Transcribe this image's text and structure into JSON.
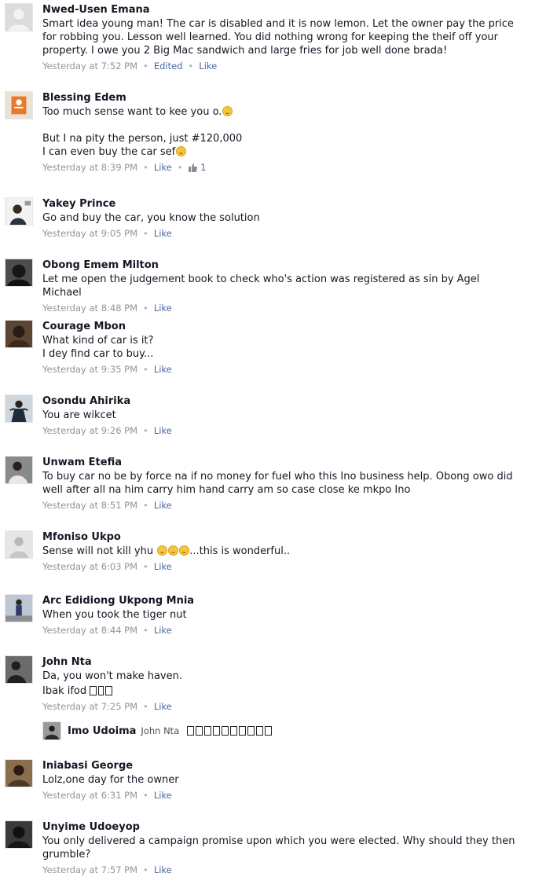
{
  "comments": [
    {
      "author": "Nwed-Usen Emana",
      "text": "Smart idea young man! The car is disabled and it is now lemon. Let the owner pay the price for robbing you. Lesson well learned. You did nothing wrong for keeping the theif off your property. I owe you 2 Big Mac sandwich and large fries for job well done brada!",
      "time": "Yesterday at 7:52 PM",
      "edited": "Edited",
      "like": "Like"
    },
    {
      "author": "Blessing Edem",
      "text_line1": "Too much sense want to kee you o.",
      "text_line2": "But I na pity the person, just #120,000",
      "text_line3": "I can even buy the car sef",
      "time": "Yesterday at 8:39 PM",
      "like": "Like",
      "like_count": "1"
    },
    {
      "author": "Yakey Prince",
      "text": "Go and buy the car, you know the solution",
      "time": "Yesterday at 9:05 PM",
      "like": "Like"
    },
    {
      "author": "Obong Emem Milton",
      "text": "Let me open the judgement book to check who's action was registered as sin by Agel Michael",
      "time": "Yesterday at 8:48 PM",
      "like": "Like"
    },
    {
      "author": "Courage Mbon",
      "text": "What kind of car is it?\nI dey find car to buy...",
      "time": "Yesterday at 9:35 PM",
      "like": "Like"
    },
    {
      "author": "Osondu Ahirika",
      "text": "You are wikcet",
      "time": "Yesterday at 9:26 PM",
      "like": "Like"
    },
    {
      "author": "Unwam Etefia",
      "text": "To buy car no be by force na if no money for fuel who this Ino business help. Obong owo did well after all na him carry him hand carry am so case close ke mkpo Ino",
      "time": "Yesterday at 8:51 PM",
      "like": "Like"
    },
    {
      "author": "Mfoniso Ukpo",
      "text_pre": "Sense will not kill yhu ",
      "text_post": "...this is wonderful..",
      "time": "Yesterday at 6:03 PM",
      "like": "Like"
    },
    {
      "author": "Arc Edidiong Ukpong Mnia",
      "text": "When you took the tiger nut",
      "time": "Yesterday at 8:44 PM",
      "like": "Like"
    },
    {
      "author": "John Nta",
      "text_line1": "Da, you won't make haven.",
      "text_line2": "Ibak ifod",
      "time": "Yesterday at 7:25 PM",
      "like": "Like",
      "reply": {
        "author": "Imo Udoima",
        "mention": "John Nta"
      }
    },
    {
      "author": "Iniabasi George",
      "text": "Lolz,one day for the owner",
      "time": "Yesterday at 6:31 PM",
      "like": "Like"
    },
    {
      "author": "Unyime Udoeyop",
      "text": "You only delivered a campaign promise upon which you were elected.  Why should they then grumble?",
      "time": "Yesterday at 7:57 PM",
      "like": "Like"
    }
  ],
  "colors": {
    "link": "#4b67a1",
    "meta": "#90949c",
    "text": "#141823"
  },
  "icons": {
    "default_avatar": "silhouette-icon",
    "like_count": "thumbs-up-icon",
    "emoji": "laughing-emoji-icon"
  }
}
